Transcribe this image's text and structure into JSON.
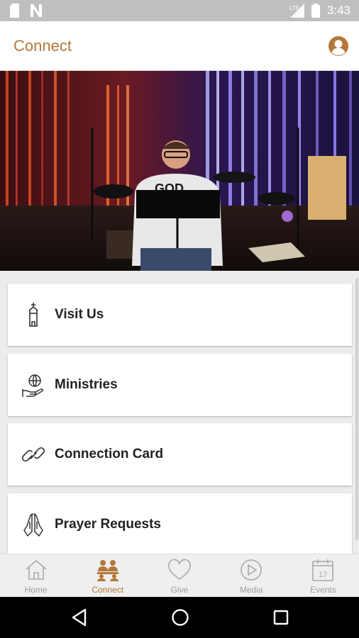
{
  "status_bar": {
    "time": "3:43",
    "icons": [
      "sd-card-icon",
      "n-notification-icon",
      "lte-signal-icon",
      "battery-icon"
    ]
  },
  "app_bar": {
    "title": "Connect",
    "profile_icon": "account-circle-icon"
  },
  "hero": {
    "shirt_text": "GOD"
  },
  "menu": {
    "items": [
      {
        "label": "Visit Us",
        "icon": "church-steeple-icon"
      },
      {
        "label": "Ministries",
        "icon": "hand-globe-icon"
      },
      {
        "label": "Connection Card",
        "icon": "link-icon"
      },
      {
        "label": "Prayer Requests",
        "icon": "praying-hands-icon"
      }
    ]
  },
  "bottom_nav": {
    "items": [
      {
        "label": "Home",
        "icon": "home-icon",
        "active": false
      },
      {
        "label": "Connect",
        "icon": "people-icon",
        "active": true
      },
      {
        "label": "Give",
        "icon": "heart-icon",
        "active": false
      },
      {
        "label": "Media",
        "icon": "play-icon",
        "active": false
      },
      {
        "label": "Events",
        "icon": "calendar-icon",
        "active": false,
        "calendar_day": "17"
      }
    ]
  },
  "colors": {
    "accent": "#b5773a",
    "inactive": "#9e9e9e",
    "status_bar": "#bfbfbf"
  }
}
